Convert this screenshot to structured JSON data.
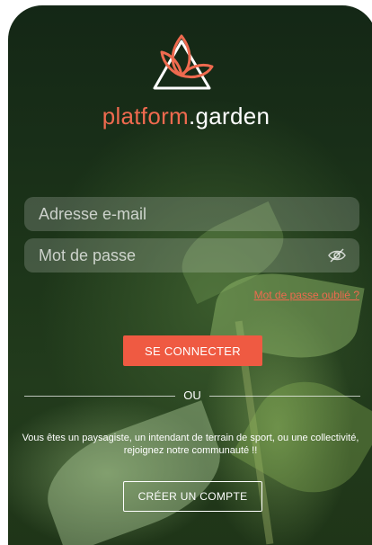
{
  "brand": {
    "part1": "platform",
    "part2": ".garden",
    "accent_color": "#ef6a4f"
  },
  "logo": {
    "icon": "leaf-triangle-logo"
  },
  "form": {
    "email_placeholder": "Adresse e-mail",
    "password_placeholder": "Mot de passe",
    "password_toggle_icon": "eye-off-icon",
    "forgot_label": "Mot de passe oublié ?",
    "login_label": "SE CONNECTER"
  },
  "separator": {
    "label": "OU"
  },
  "signup": {
    "info_text": "Vous êtes un paysagiste, un intendant de terrain de sport, ou une collectivité, rejoignez notre communauté !!",
    "create_label": "CRÉER UN COMPTE"
  }
}
